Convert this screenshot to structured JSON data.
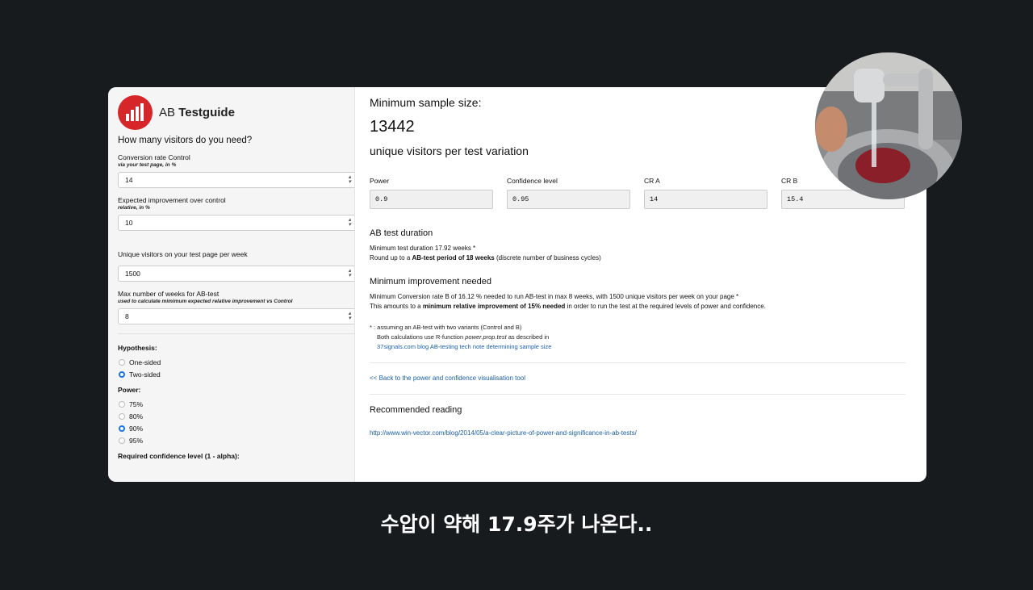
{
  "brand": {
    "prefix": "AB",
    "name": "Testguide"
  },
  "sidebar": {
    "heading": "How many visitors do you need?",
    "fields": [
      {
        "label": "Conversion rate Control",
        "sub": "via your test page, in %",
        "value": "14"
      },
      {
        "label": "Expected improvement over control",
        "sub": "relative, in %",
        "value": "10"
      },
      {
        "label": "Unique visitors on your test page per week",
        "sub": "",
        "value": "1500"
      },
      {
        "label": "Max number of weeks for AB-test",
        "sub": "used to calculate mimimum expected relative improvement vs Control",
        "value": "8"
      }
    ],
    "hypothesis": {
      "title": "Hypothesis:",
      "options": [
        "One-sided",
        "Two-sided"
      ],
      "selected": "Two-sided"
    },
    "power": {
      "title": "Power:",
      "options": [
        "75%",
        "80%",
        "90%",
        "95%"
      ],
      "selected": "90%"
    },
    "confidence_title": "Required confidence level (1 - alpha):"
  },
  "main": {
    "title": "Minimum sample size:",
    "sample_size": "13442",
    "subtitle": "unique visitors per test variation",
    "inputs": [
      {
        "label": "Power",
        "value": "0.9"
      },
      {
        "label": "Confidence level",
        "value": "0.95"
      },
      {
        "label": "CR A",
        "value": "14"
      },
      {
        "label": "CR B",
        "value": "15.4"
      }
    ],
    "duration": {
      "title": "AB test duration",
      "line1": "Minimum test duration 17.92 weeks *",
      "line2_pre": "Round up to a ",
      "line2_bold": "AB-test period of 18 weeks",
      "line2_post": " (discrete number of business cycles)"
    },
    "improvement": {
      "title": "Minimum improvement needed",
      "line1": "Minimum Conversion rate B of 16.12 % needed to run AB-test in max 8 weeks, with 1500 unique visitors per week on your page *",
      "line2_pre": "This amounts to a ",
      "line2_bold": "minimum relative improvement of 15% needed",
      "line2_post": " in order to run the test at the required levels of power and confidence."
    },
    "note": {
      "line1": "* : assuming an AB-test with two variants (Control and B)",
      "line2_pre": "Both calculations use R-function ",
      "line2_italic": "power.prop.test",
      "line2_post": " as described in",
      "link": "37signals.com blog AB-testing tech note determining sample size"
    },
    "back_link": "<< Back to the power and confidence visualisation tool",
    "reading": {
      "title": "Recommended reading",
      "link": "http://www.win-vector.com/blog/2014/05/a-clear-picture-of-power-and-significance-in-ab-tests/"
    }
  },
  "caption": "수압이 약해 17.9주가 나온다.."
}
